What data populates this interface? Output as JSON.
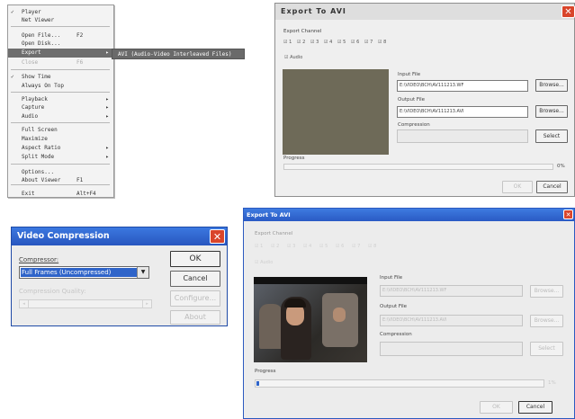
{
  "menu": {
    "items": [
      {
        "check": "✓",
        "label": "Player",
        "shortcut": "",
        "arrow": ""
      },
      {
        "check": "",
        "label": "Net Viewer",
        "shortcut": "",
        "arrow": ""
      },
      {
        "check": "",
        "label": "Open File...",
        "shortcut": "F2",
        "arrow": ""
      },
      {
        "check": "",
        "label": "Open Disk...",
        "shortcut": "",
        "arrow": ""
      },
      {
        "check": "",
        "label": "Export",
        "shortcut": "",
        "arrow": "▸"
      },
      {
        "check": "",
        "label": "Close",
        "shortcut": "F6",
        "arrow": ""
      },
      {
        "check": "✓",
        "label": "Show Time",
        "shortcut": "",
        "arrow": ""
      },
      {
        "check": "",
        "label": "Always On Top",
        "shortcut": "",
        "arrow": ""
      },
      {
        "check": "",
        "label": "Playback",
        "shortcut": "",
        "arrow": "▸"
      },
      {
        "check": "",
        "label": "Capture",
        "shortcut": "",
        "arrow": "▸"
      },
      {
        "check": "",
        "label": "Audio",
        "shortcut": "",
        "arrow": "▸"
      },
      {
        "check": "",
        "label": "Full Screen",
        "shortcut": "",
        "arrow": ""
      },
      {
        "check": "",
        "label": "Maximize",
        "shortcut": "",
        "arrow": ""
      },
      {
        "check": "",
        "label": "Aspect Ratio",
        "shortcut": "",
        "arrow": "▸"
      },
      {
        "check": "",
        "label": "Split Mode",
        "shortcut": "",
        "arrow": "▸"
      },
      {
        "check": "",
        "label": "Options...",
        "shortcut": "",
        "arrow": ""
      },
      {
        "check": "",
        "label": "About Viewer",
        "shortcut": "F1",
        "arrow": ""
      },
      {
        "check": "",
        "label": "Exit",
        "shortcut": "Alt+F4",
        "arrow": ""
      }
    ],
    "submenu_label": "AVI (Audio-Video Interleaved Files)"
  },
  "export1": {
    "title": "Export To AVI",
    "close": "✕",
    "export_channel_label": "Export Channel",
    "channels": [
      "☑ 1",
      "☑ 2",
      "☑ 3",
      "☑ 4",
      "☑ 5",
      "☑ 6",
      "☑ 7",
      "☑ 8"
    ],
    "audio_label": "☑ Audio",
    "input_label": "Input File",
    "input_value": "E:\\VIDEO\\BCH\\AV111213.WF",
    "browse1": "Browse...",
    "output_label": "Output File",
    "output_value": "E:\\VIDEO\\BCH\\AV111213.AVI",
    "browse2": "Browse...",
    "compression_label": "Compression",
    "compression_value": "",
    "select": "Select",
    "progress_label": "Progress",
    "progress_pct": "0%",
    "ok": "OK",
    "cancel": "Cancel",
    "progress_fraction": 0
  },
  "compression": {
    "title": "Video Compression",
    "close": "✕",
    "compressor_label": "Compressor:",
    "compressor_value": "Full Frames (Uncompressed)",
    "quality_label": "Compression Quality:",
    "ok": "OK",
    "cancel": "Cancel",
    "configure": "Configure...",
    "about": "About"
  },
  "export2": {
    "title": "Export To AVI",
    "close": "✕",
    "export_channel_label": "Export Channel",
    "channels": [
      "☑ 1",
      "☑ 2",
      "☑ 3",
      "☑ 4",
      "☑ 5",
      "☑ 6",
      "☑ 7",
      "☑ 8"
    ],
    "audio_label": "☑ Audio",
    "input_label": "Input File",
    "input_value": "E:\\VIDEO\\BCH\\AV111213.WF",
    "browse1": "Browse...",
    "output_label": "Output File",
    "output_value": "E:\\VIDEO\\BCH\\AV111213.AVI",
    "browse2": "Browse...",
    "compression_label": "Compression",
    "select": "Select",
    "progress_label": "Progress",
    "progress_pct": "1%",
    "ok": "OK",
    "cancel": "Cancel",
    "progress_fraction": 0.01
  },
  "colors": {
    "xp_blue": "#2f64c9",
    "preview_gray": "#6e6a58",
    "menu_highlight": "#6e6e6e"
  }
}
